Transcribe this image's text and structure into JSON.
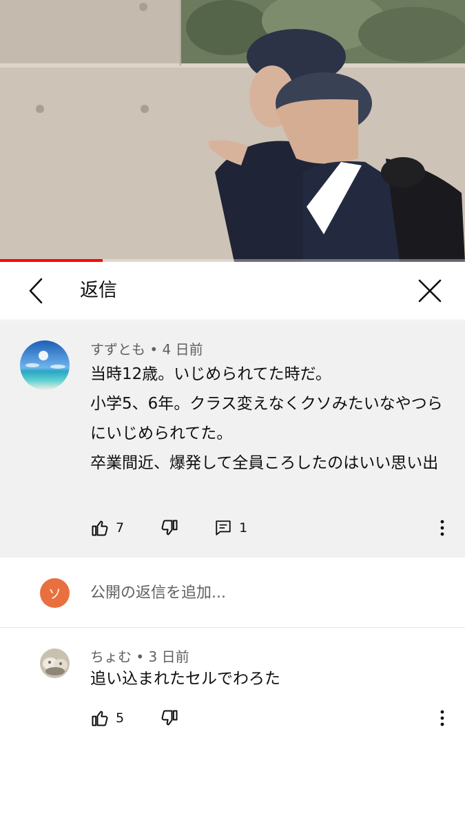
{
  "video": {
    "progress_fraction": 0.22
  },
  "header": {
    "title": "返信",
    "back_icon": "chevron-left-icon",
    "close_icon": "close-icon"
  },
  "comment": {
    "author": "すずとも",
    "separator": " • ",
    "time": "4 日前",
    "paragraphs": [
      "当時12歳。いじめられてた時だ。",
      "小学5、6年。クラス変えなくクソみたいなやつらにいじめられてた。",
      "卒業間近、爆発して全員ころしたのはいい思い出"
    ],
    "likes": "7",
    "replies": "1"
  },
  "add_reply": {
    "avatar_initial": "ソ",
    "avatar_color": "#e9703e",
    "placeholder": "公開の返信を追加..."
  },
  "reply": {
    "author": "ちょむ",
    "separator": " • ",
    "time": "3 日前",
    "text": "追い込まれたセルでわろた",
    "likes": "5"
  },
  "colors": {
    "accent": "#ff0000",
    "parent_background": "#f1f1f1",
    "secondary_text": "#606060"
  }
}
